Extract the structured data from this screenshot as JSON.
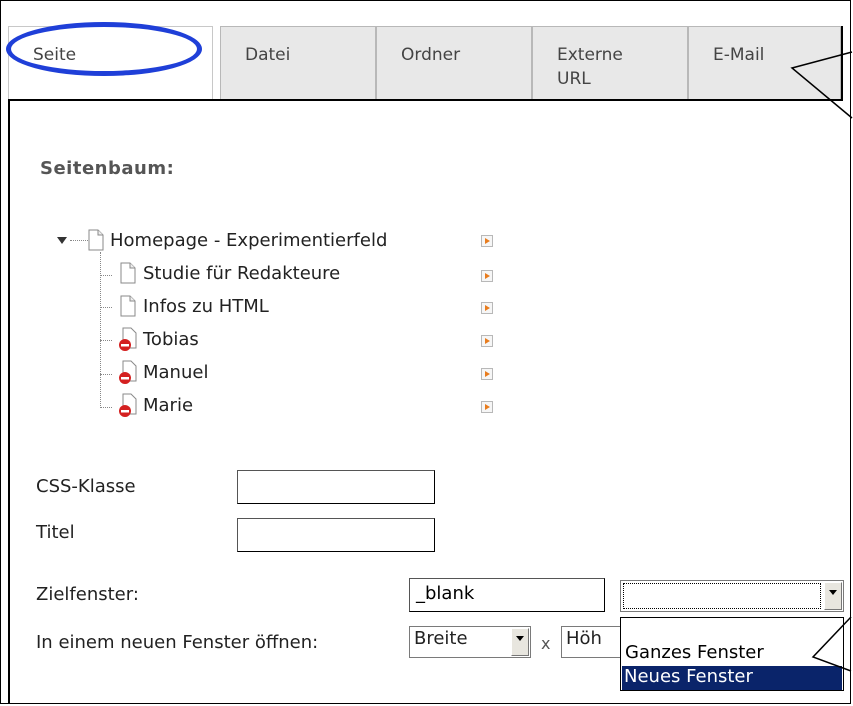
{
  "tabs": [
    {
      "label": "Seite",
      "active": true
    },
    {
      "label": "Datei",
      "active": false
    },
    {
      "label": "Ordner",
      "active": false
    },
    {
      "label": "Externe URL",
      "active": false
    },
    {
      "label": "E-Mail",
      "active": false
    }
  ],
  "tree": {
    "heading": "Seitenbaum:",
    "root": "Homepage - Experimentierfeld",
    "children": [
      {
        "label": "Studie für Redakteure",
        "restricted": false
      },
      {
        "label": "Infos zu HTML",
        "restricted": false
      },
      {
        "label": "Tobias",
        "restricted": true
      },
      {
        "label": "Manuel",
        "restricted": true
      },
      {
        "label": "Marie",
        "restricted": true
      }
    ]
  },
  "form": {
    "css_label": "CSS-Klasse",
    "css_value": "",
    "title_label": "Titel",
    "title_value": "",
    "target_label": "Zielfenster:",
    "target_value": "_blank",
    "target_select_value": "",
    "newwin_label": "In einem neuen Fenster öffnen:",
    "width_select": "Breite",
    "times": "x",
    "height_select": "Höh"
  },
  "dropdown": {
    "options": [
      "Ganzes Fenster",
      "Neues Fenster"
    ],
    "highlighted": "Neues Fenster",
    "highlight_color": "#0a246a"
  },
  "annotation_color": "#1f3fd8"
}
